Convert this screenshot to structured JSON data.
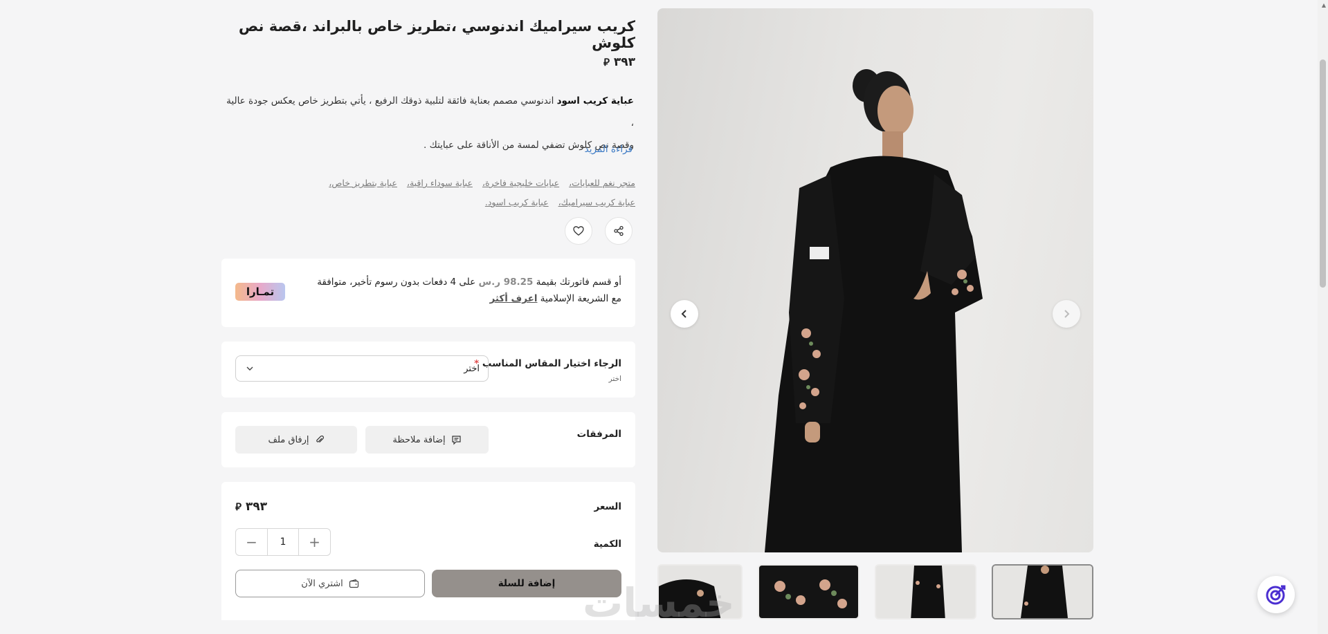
{
  "product": {
    "title": "كريب سيراميك اندنوسي ،تطريز خاص بالبراند ،قصة نص كلوش",
    "price": "٣٩٣",
    "currency_symbol": "⃁",
    "description_bold": "عباية كريب اسود",
    "description_line1": " اندنوسي مصمم بعناية فائقة لتلبية ذوقك الرفيع ، يأتي بتطريز خاص يعكس جودة عالية ،",
    "description_line2": "وقصة نص كلوش تضفي لمسة من الأناقة على عبايتك .",
    "read_more": "قراءة المزيد",
    "tags": [
      "متجر نغم للعبايات،",
      "عبايات خليجية فاخرة،",
      "عباية سوداء راقية،",
      "عباية بتطريز خاص،",
      "عباية كريب سيراميك،",
      "عباية كريب اسود."
    ]
  },
  "tamara": {
    "text_before": "أو قسم فاتورتك بقيمة ",
    "amount": "98.25",
    "currency": " ر.س",
    "text_after": " على 4 دفعات بدون رسوم تأخير، متوافقة مع الشريعة الإسلامية ",
    "learn_more": "اعرف أكثر",
    "logo_text": "تمـارا"
  },
  "size": {
    "label": "الرجاء اختيار المقاس المناسب",
    "required_mark": "*",
    "sub": "اختر",
    "select_value": "اختر"
  },
  "attachments": {
    "label": "المرفقات",
    "add_note": "إضافة ملاحظة",
    "attach_file": "إرفاق ملف"
  },
  "purchase": {
    "price_label": "السعر",
    "price_value": "٣٩٣",
    "quantity_label": "الكمية",
    "quantity": "1",
    "add_to_cart": "إضافة للسلة",
    "buy_now": "اشتري الآن"
  },
  "gallery": {
    "thumbnail_count": 4,
    "active_thumbnail": 4
  },
  "watermark": "خمسات",
  "colors": {
    "link": "#3a79c4",
    "add_to_cart_bg": "#95908c",
    "required": "#e04e4e"
  }
}
